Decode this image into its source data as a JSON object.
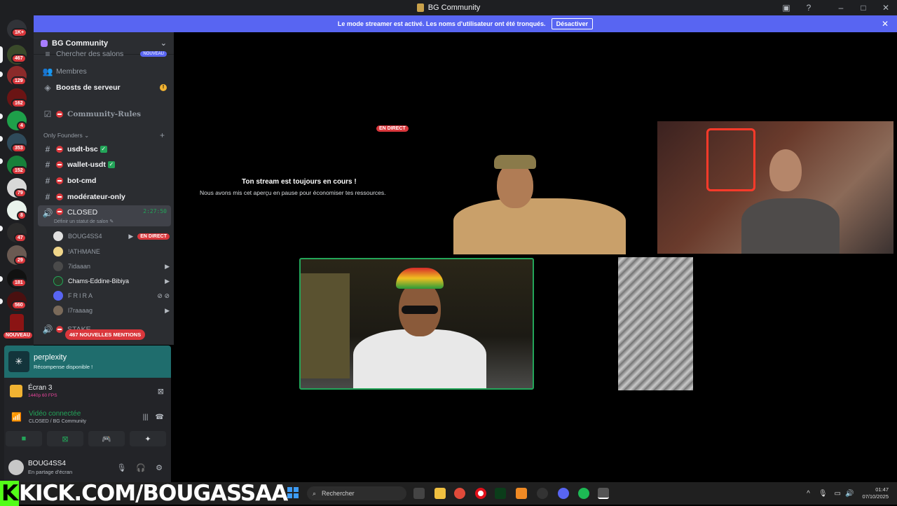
{
  "window": {
    "title": "BG Community"
  },
  "banner": {
    "text": "Le mode streamer est activé. Les noms d'utilisateur ont été tronqués.",
    "button": "Désactiver"
  },
  "guild_badges": [
    "1K+",
    "467",
    "129",
    "162",
    "4",
    "353",
    "152",
    "79",
    "8",
    "47",
    "29",
    "181",
    "560"
  ],
  "guild_new_label": "NOUVEAU",
  "server": {
    "name": "BG Community",
    "search_channels": "Chercher des salons",
    "search_badge": "NOUVEAU",
    "members": "Membres",
    "boosts": "Boosts de serveur",
    "rules_channel": "Community-Rules",
    "category": "Only Founders",
    "channels": [
      "usdt-bsc",
      "wallet-usdt",
      "bot-cmd",
      "modérateur-only"
    ],
    "voice_channel": "CLOSED",
    "voice_timer": "2:27:50",
    "voice_status_hint": "Définir un statut de salon",
    "voice_users": [
      "BOUG4SS4",
      "!ATHMANE",
      "7idaaan",
      "Chams-Eddine-Bibiya",
      "FRIRA",
      "l7raaaag"
    ],
    "live_badge": "EN DIRECT",
    "next_voice": "STAKE",
    "mentions": "467 NOUVELLES MENTIONS"
  },
  "promo": {
    "title": "perplexity",
    "subtitle": "Récompense disponible !"
  },
  "screen": {
    "title": "Écran 3",
    "sub": "1440p 60 FPS"
  },
  "voice": {
    "status": "Vidéo connectée",
    "location": "CLOSED / BG Community"
  },
  "user": {
    "name": "BOUG4SS4",
    "status": "En partage d'écran"
  },
  "stage": {
    "live_badge": "EN DIRECT",
    "paused_title": "Ton stream est toujours en cours !",
    "paused_sub": "Nous avons mis cet aperçu en pause pour économiser tes ressources."
  },
  "taskbar": {
    "overlay": "KICK.COM/BOUGASSAA",
    "search": "Rechercher",
    "time": "01:47",
    "date": "07/10/2025"
  },
  "colors": {
    "accent": "#5865f2",
    "danger": "#da373c",
    "online": "#23a559",
    "kick": "#53fc18"
  }
}
